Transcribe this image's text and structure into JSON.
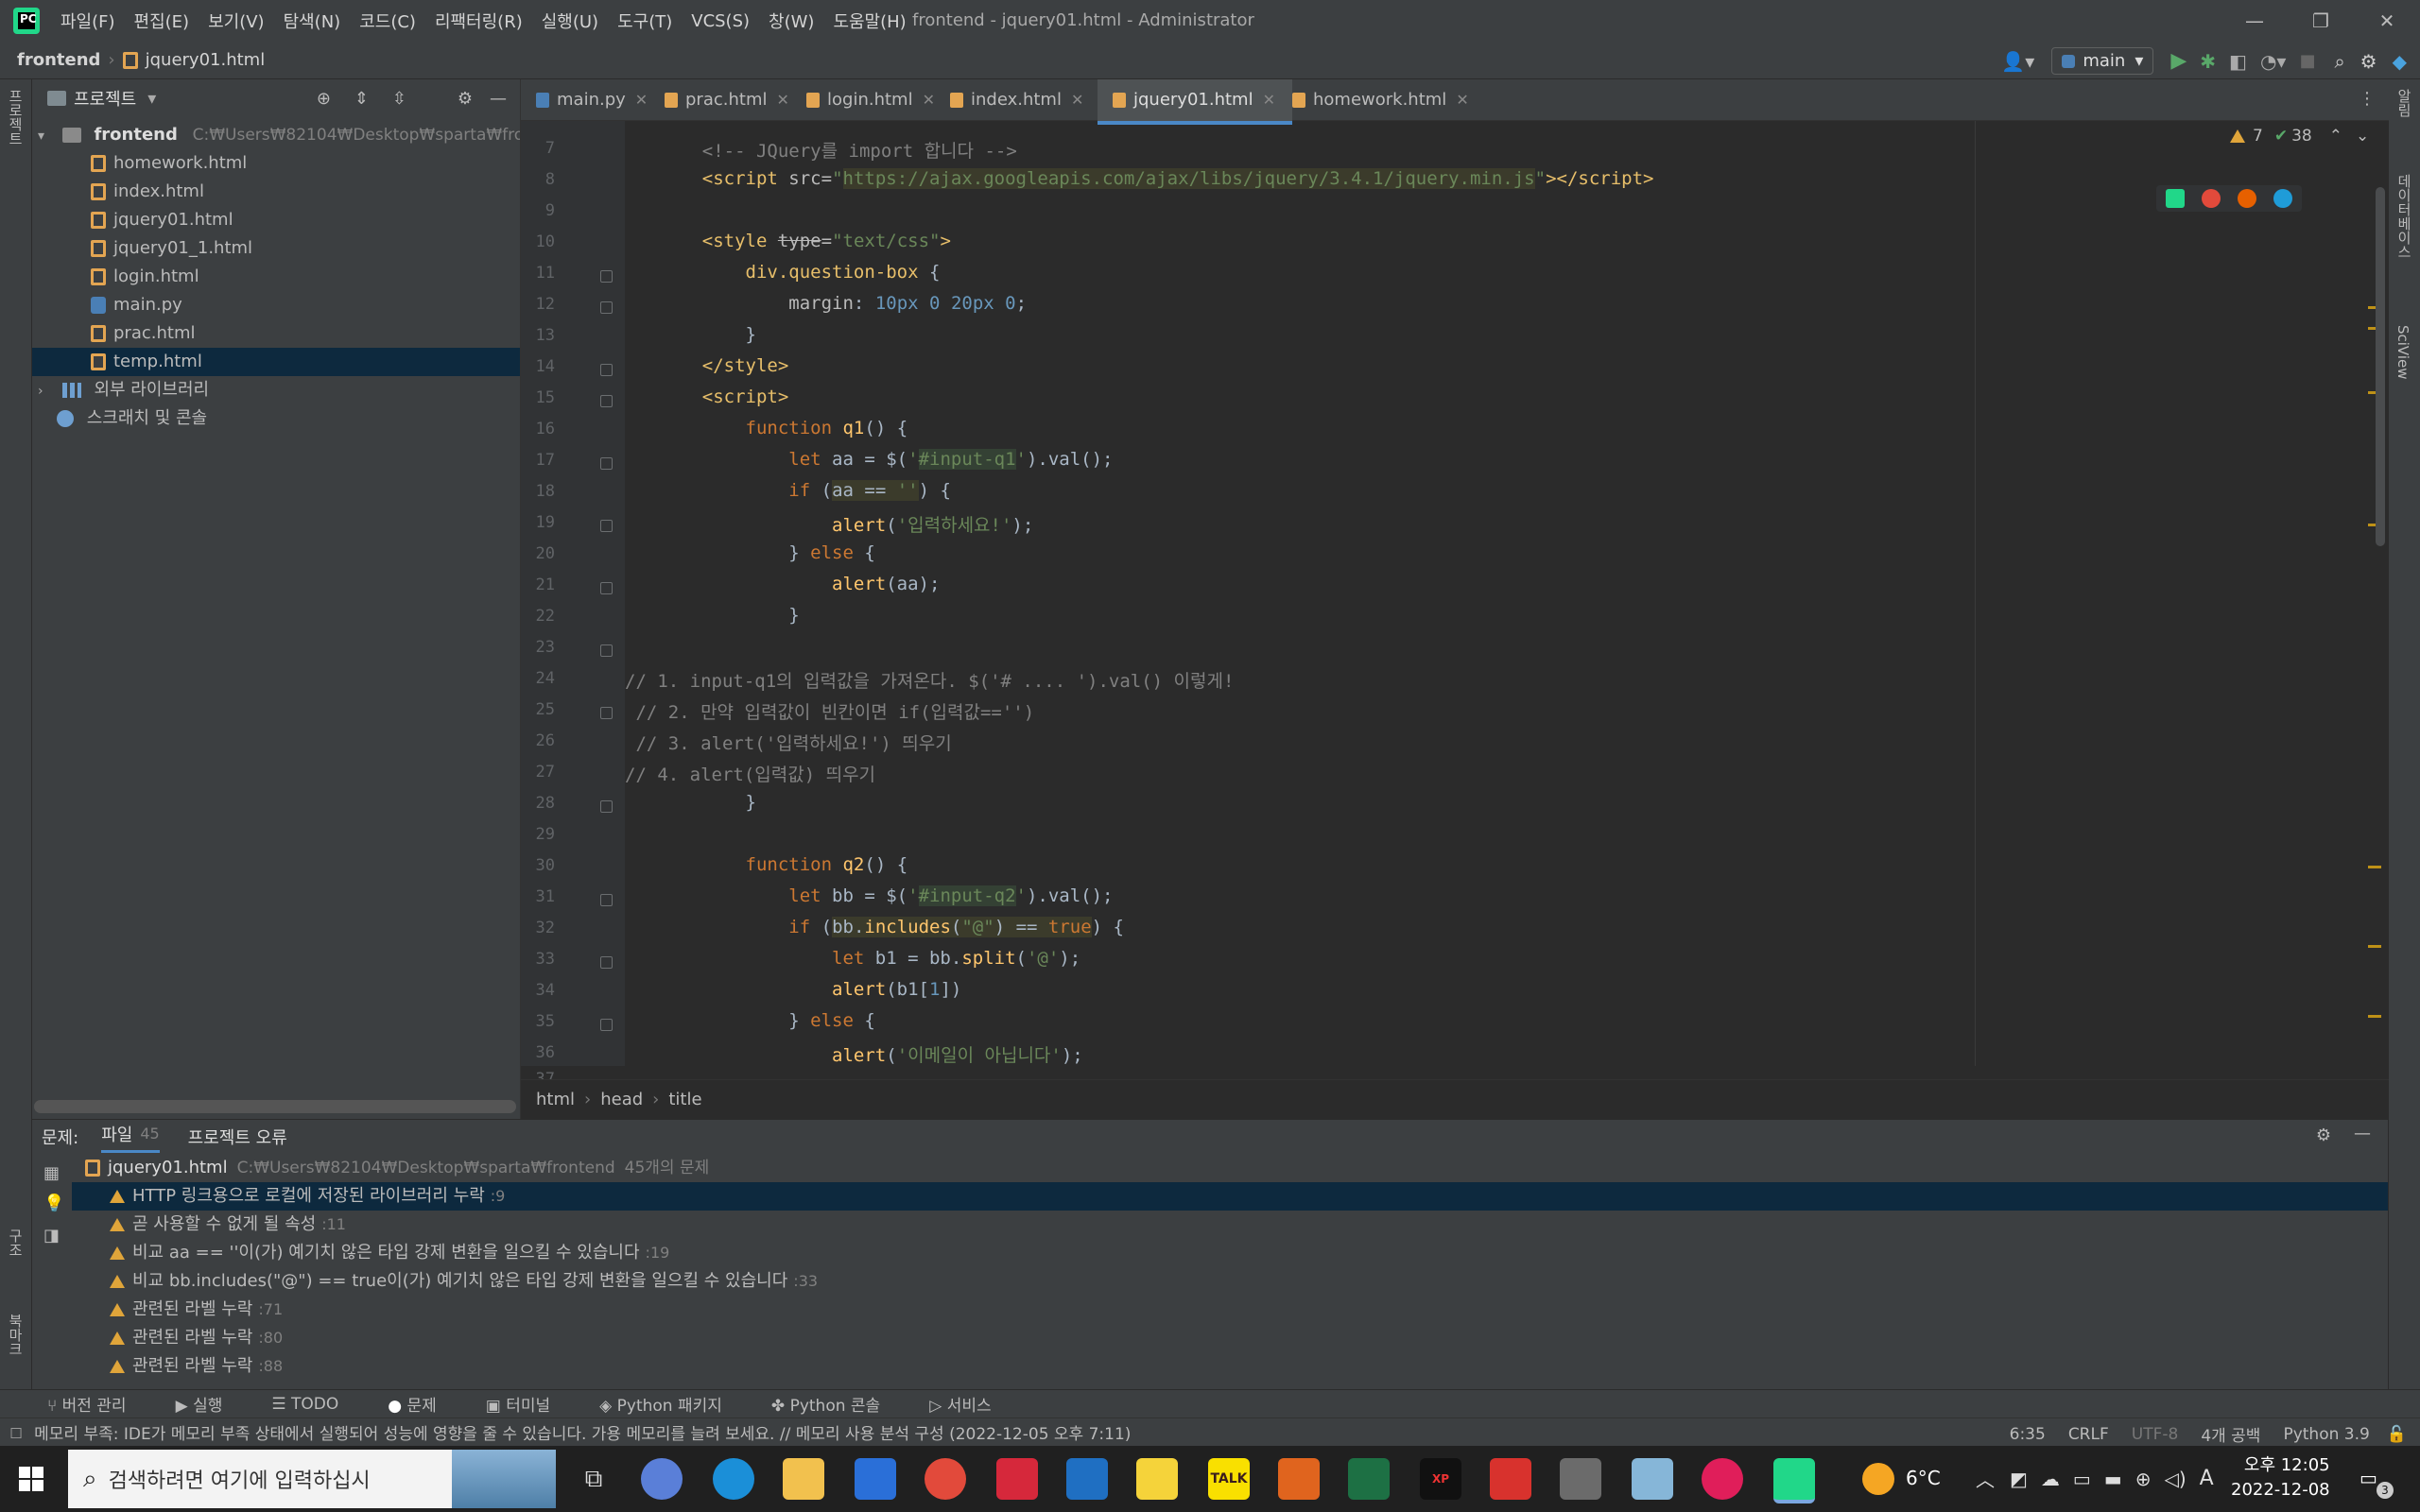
{
  "titlebar": {
    "menu": [
      "파일(F)",
      "편집(E)",
      "보기(V)",
      "탐색(N)",
      "코드(C)",
      "리팩터링(R)",
      "실행(U)",
      "도구(T)",
      "VCS(S)",
      "창(W)",
      "도움말(H)"
    ],
    "title": "frontend - jquery01.html - Administrator"
  },
  "navbar": {
    "project": "frontend",
    "file": "jquery01.html",
    "run_config": "main"
  },
  "left_stripe": {
    "project_label": "프로젝트",
    "structure_label": "구조",
    "bookmarks_label": "북마크"
  },
  "right_stripe": {
    "database_label": "데이터베이스",
    "sciview_label": "SciView",
    "notifications_label": "알림"
  },
  "project_panel": {
    "title": "프로젝트",
    "root": {
      "name": "frontend",
      "path": "C:₩Users₩82104₩Desktop₩sparta₩frontend"
    },
    "files": [
      {
        "name": "homework.html",
        "type": "html"
      },
      {
        "name": "index.html",
        "type": "html"
      },
      {
        "name": "jquery01.html",
        "type": "html"
      },
      {
        "name": "jquery01_1.html",
        "type": "html"
      },
      {
        "name": "login.html",
        "type": "html"
      },
      {
        "name": "main.py",
        "type": "py"
      },
      {
        "name": "prac.html",
        "type": "html"
      },
      {
        "name": "temp.html",
        "type": "html"
      }
    ],
    "external_libs": "외부 라이브러리",
    "scratches": "스크래치 및 콘솔"
  },
  "tabs": [
    "main.py",
    "prac.html",
    "login.html",
    "index.html",
    "jquery01.html",
    "homework.html"
  ],
  "inspection": {
    "warnings": "7",
    "checks": "38"
  },
  "code_lines": [
    {
      "n": "7"
    },
    {
      "n": "8"
    },
    {
      "n": "9"
    },
    {
      "n": "10"
    },
    {
      "n": "11"
    },
    {
      "n": "12"
    },
    {
      "n": "13"
    },
    {
      "n": "14"
    },
    {
      "n": "15"
    },
    {
      "n": "16"
    },
    {
      "n": "17"
    },
    {
      "n": "18"
    },
    {
      "n": "19"
    },
    {
      "n": "20"
    },
    {
      "n": "21"
    },
    {
      "n": "22"
    },
    {
      "n": "23"
    },
    {
      "n": "24"
    },
    {
      "n": "25"
    },
    {
      "n": "26"
    },
    {
      "n": "27"
    },
    {
      "n": "28"
    },
    {
      "n": "29"
    },
    {
      "n": "30"
    },
    {
      "n": "31"
    },
    {
      "n": "32"
    },
    {
      "n": "33"
    },
    {
      "n": "34"
    },
    {
      "n": "35"
    },
    {
      "n": "36"
    },
    {
      "n": "37"
    }
  ],
  "editor_breadcrumb": [
    "html",
    "head",
    "title"
  ],
  "problems": {
    "label": "문제:",
    "tab_file": "파일",
    "tab_file_count": "45",
    "tab_project": "프로젝트 오류",
    "file": "jquery01.html",
    "file_path": "C:₩Users₩82104₩Desktop₩sparta₩frontend",
    "file_count": "45개의 문제",
    "items": [
      {
        "text": "HTTP 링크용으로 로컬에 저장된 라이브러리 누락",
        "line": ":9"
      },
      {
        "text": "곧 사용할 수 없게 될 속성",
        "line": ":11"
      },
      {
        "text": "비교 aa == ''이(가) 예기치 않은 타입 강제 변환을 일으킬 수 있습니다",
        "line": ":19"
      },
      {
        "text": "비교 bb.includes(\"@\") == true이(가) 예기치 않은 타입 강제 변환을 일으킬 수 있습니다",
        "line": ":33"
      },
      {
        "text": "관련된 라벨 누락",
        "line": ":71"
      },
      {
        "text": "관련된 라벨 누락",
        "line": ":80"
      },
      {
        "text": "관련된 라벨 누락",
        "line": ":88"
      }
    ]
  },
  "bottom_tools": [
    "버전 관리",
    "실행",
    "TODO",
    "문제",
    "터미널",
    "Python 패키지",
    "Python 콘솔",
    "서비스"
  ],
  "status": {
    "message": "메모리 부족: IDE가 메모리 부족 상태에서 실행되어 성능에 영향을 줄 수 있습니다. 가용 메모리를 늘려 보세요. // 메모리 사용 분석   구성 (2022-12-05 오후 7:11)",
    "position": "6:35",
    "line_sep": "CRLF",
    "encoding": "UTF-8",
    "indent": "4개 공백",
    "interpreter": "Python 3.9"
  },
  "taskbar": {
    "search_placeholder": "검색하려면 여기에 입력하십시",
    "weather": "6°C",
    "ime": "A",
    "time": "오후 12:05",
    "date": "2022-12-08",
    "notif_count": "3"
  }
}
